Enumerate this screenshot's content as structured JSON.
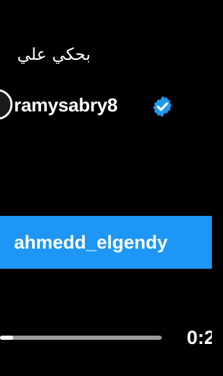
{
  "caption": {
    "text": "بحكي علي"
  },
  "account": {
    "username": "ramysabry8",
    "verified": true,
    "verified_color": "#1d9bf0",
    "avatar_icon": "avatar-ring"
  },
  "tag": {
    "label": "ahmedd_elgendy",
    "background": "#1e96f5"
  },
  "player": {
    "progress_fraction": 0.08,
    "time_text": "0:2"
  }
}
